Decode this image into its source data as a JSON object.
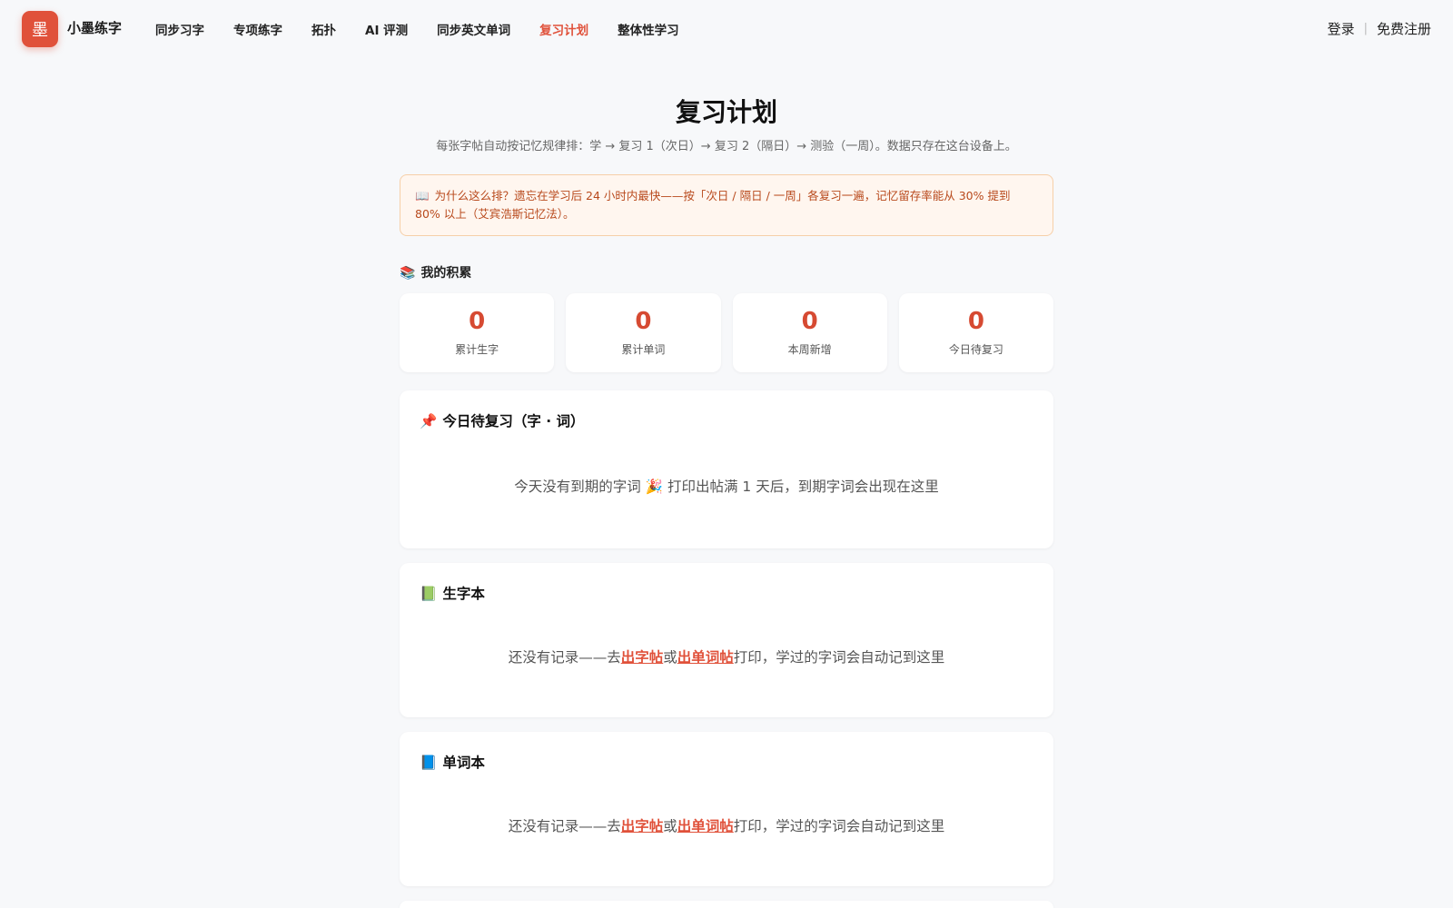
{
  "brand": {
    "logo_char": "墨",
    "name": "小墨练字"
  },
  "nav": [
    {
      "label": "同步习字",
      "active": false
    },
    {
      "label": "专项练字",
      "active": false
    },
    {
      "label": "拓扑",
      "active": false
    },
    {
      "label": "AI 评测",
      "active": false
    },
    {
      "label": "同步英文单词",
      "active": false
    },
    {
      "label": "复习计划",
      "active": true
    },
    {
      "label": "整体性学习",
      "active": false
    }
  ],
  "auth": {
    "login": "登录",
    "separator": "|",
    "register": "免费注册"
  },
  "page": {
    "title": "复习计划",
    "subtitle": "每张字帖自动按记忆规律排：学 → 复习 1（次日）→ 复习 2（隔日）→ 测验（一周）。数据只存在这台设备上。"
  },
  "notice": {
    "icon": "📖",
    "text": "为什么这么排？遗忘在学习后 24 小时内最快——按「次日 / 隔日 / 一周」各复习一遍，记忆留存率能从 30% 提到 80% 以上（艾宾浩斯记忆法）。"
  },
  "accumulation": {
    "icon": "📚",
    "label": "我的积累",
    "stats": [
      {
        "value": "0",
        "label": "累计生字"
      },
      {
        "value": "0",
        "label": "累计单词"
      },
      {
        "value": "0",
        "label": "本周新增"
      },
      {
        "value": "0",
        "label": "今日待复习"
      }
    ]
  },
  "today": {
    "icon": "📌",
    "title": "今日待复习（字 · 词）",
    "empty_a": "今天没有到期的字词",
    "empty_emoji": "🎉",
    "empty_b": "打印出帖满 1 天后，到期字词会出现在这里"
  },
  "char_book": {
    "icon": "📗",
    "title": "生字本",
    "empty_pre": "还没有记录——去",
    "link1": "出字帖",
    "mid": "或",
    "link2": "出单词帖",
    "empty_post": "打印，学过的字词会自动记到这里"
  },
  "word_book": {
    "icon": "📘",
    "title": "单词本",
    "empty_pre": "还没有记录——去",
    "link1": "出字帖",
    "mid": "或",
    "link2": "出单词帖",
    "empty_post": "打印，学过的字词会自动记到这里"
  },
  "colors": {
    "accent": "#e0513a",
    "notice_bg": "#fff6ef",
    "notice_text": "#b8491c"
  }
}
